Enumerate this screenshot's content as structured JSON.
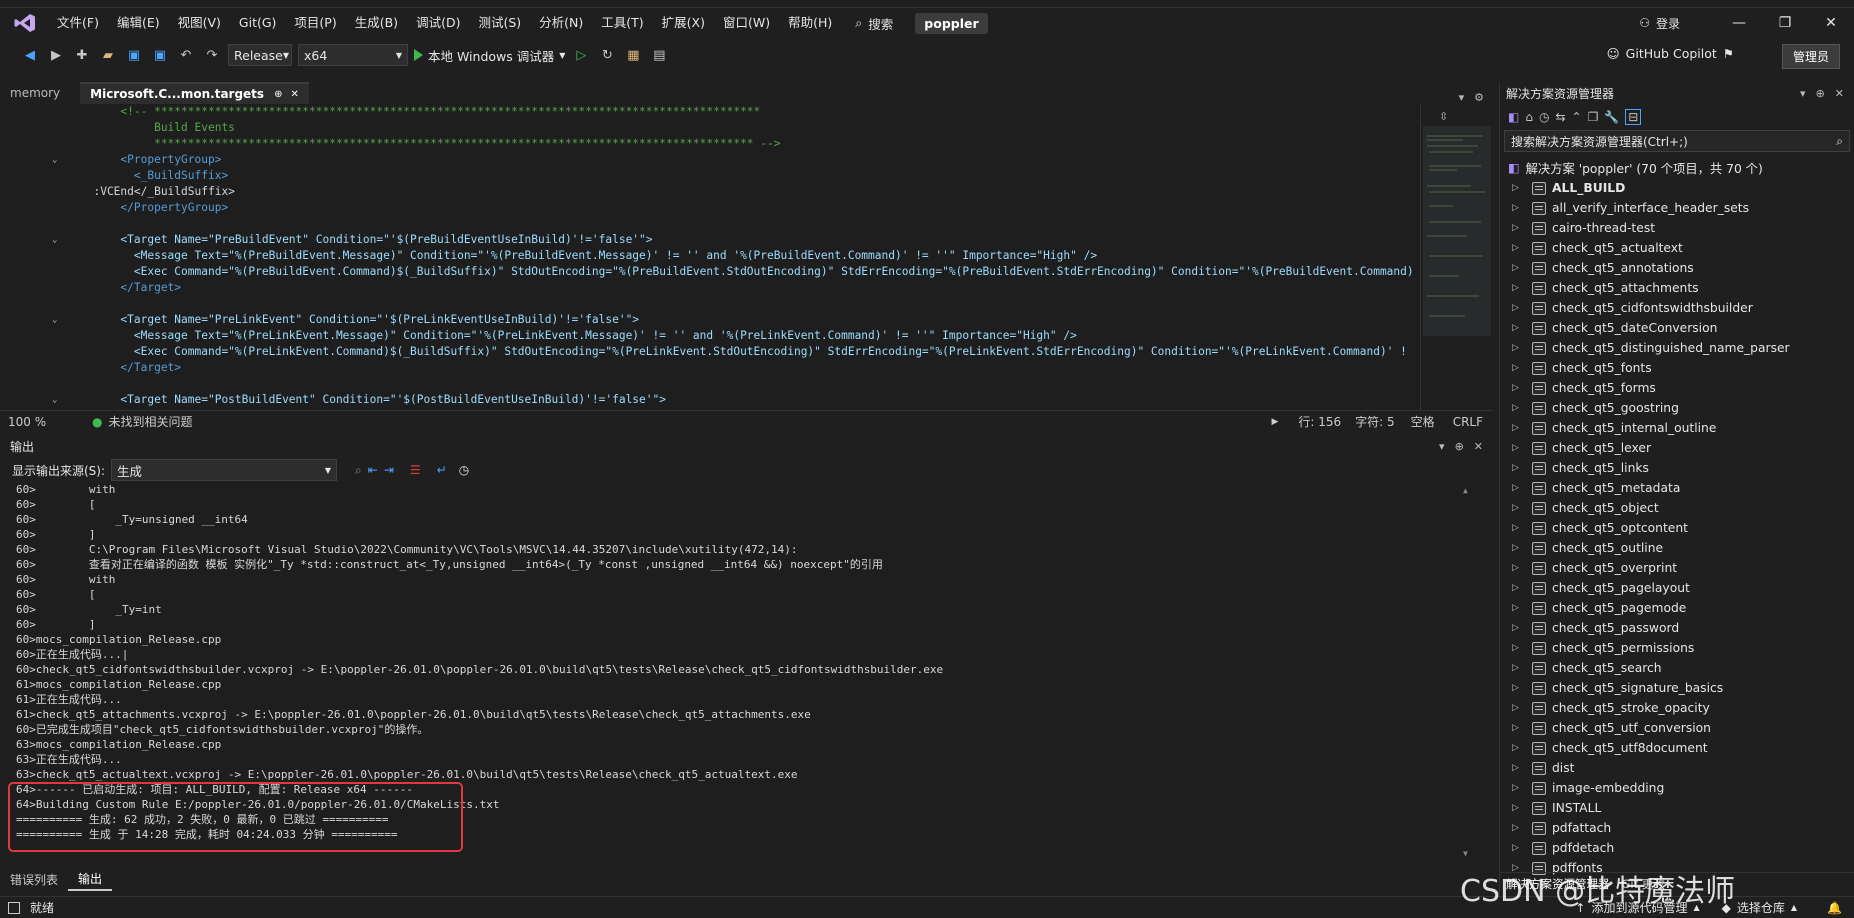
{
  "menubar": {
    "items": [
      "文件(F)",
      "编辑(E)",
      "视图(V)",
      "Git(G)",
      "项目(P)",
      "生成(B)",
      "调试(D)",
      "测试(S)",
      "分析(N)",
      "工具(T)",
      "扩展(X)",
      "窗口(W)",
      "帮助(H)"
    ],
    "search_label": "搜索",
    "project_name": "poppler",
    "login_label": "登录"
  },
  "toolbar": {
    "config": "Release",
    "platform": "x64",
    "run_label": "本地 Windows 调试器",
    "copilot_label": "GitHub Copilot",
    "manage_label": "管理员"
  },
  "tabs": [
    {
      "label": "memory"
    },
    {
      "label": "Microsoft.C...mon.targets",
      "pin": "⊕",
      "close": "✕"
    }
  ],
  "editor": {
    "lines": [
      {
        "t": "com",
        "text": "      <!-- ******************************************************************************************"
      },
      {
        "t": "com",
        "text": "           Build Events"
      },
      {
        "t": "com",
        "text": "           ***************************************************************************************** -->"
      },
      {
        "t": "tag",
        "text": "      <PropertyGroup>"
      },
      {
        "t": "tag",
        "text": "        <_BuildSuffix>"
      },
      {
        "t": "txt",
        "text": "  :VCEnd</_BuildSuffix>"
      },
      {
        "t": "tag",
        "text": "      </PropertyGroup>"
      },
      {
        "t": "txt",
        "text": ""
      },
      {
        "t": "mix",
        "text": "      <Target Name=\"PreBuildEvent\" Condition=\"'$(PreBuildEventUseInBuild)'!='false'\">"
      },
      {
        "t": "mix",
        "text": "        <Message Text=\"%(PreBuildEvent.Message)\" Condition=\"'%(PreBuildEvent.Message)' != '' and '%(PreBuildEvent.Command)' != ''\" Importance=\"High\" />"
      },
      {
        "t": "mix",
        "text": "        <Exec Command=\"%(PreBuildEvent.Command)$(_BuildSuffix)\" StdOutEncoding=\"%(PreBuildEvent.StdOutEncoding)\" StdErrEncoding=\"%(PreBuildEvent.StdErrEncoding)\" Condition=\"'%(PreBuildEvent.Command)"
      },
      {
        "t": "tag",
        "text": "      </Target>"
      },
      {
        "t": "txt",
        "text": ""
      },
      {
        "t": "mix",
        "text": "      <Target Name=\"PreLinkEvent\" Condition=\"'$(PreLinkEventUseInBuild)'!='false'\">"
      },
      {
        "t": "mix",
        "text": "        <Message Text=\"%(PreLinkEvent.Message)\" Condition=\"'%(PreLinkEvent.Message)' != '' and '%(PreLinkEvent.Command)' != ''\" Importance=\"High\" />"
      },
      {
        "t": "mix",
        "text": "        <Exec Command=\"%(PreLinkEvent.Command)$(_BuildSuffix)\" StdOutEncoding=\"%(PreLinkEvent.StdOutEncoding)\" StdErrEncoding=\"%(PreLinkEvent.StdErrEncoding)\" Condition=\"'%(PreLinkEvent.Command)' !"
      },
      {
        "t": "tag",
        "text": "      </Target>"
      },
      {
        "t": "txt",
        "text": ""
      },
      {
        "t": "mix",
        "text": "      <Target Name=\"PostBuildEvent\" Condition=\"'$(PostBuildEventUseInBuild)'!='false'\">"
      },
      {
        "t": "mix",
        "text": "        <Message Text=\"%(PostBuildEvent.Message)\" Condition=\"'%(PostBuildEvent.Message)' != '' and '%(PostBuildEvent.Command)' != ''\" Importance=\"High\" />"
      }
    ]
  },
  "editor_status": {
    "zoom": "100 %",
    "issues": "未找到相关问题",
    "line": "行: 156",
    "col": "字符: 5",
    "spacing": "空格",
    "eol": "CRLF"
  },
  "output": {
    "title": "输出",
    "source_label": "显示输出来源(S):",
    "source_value": "生成",
    "lines": [
      "60>        with",
      "60>        [",
      "60>            _Ty=unsigned __int64",
      "60>        ]",
      "60>        C:\\Program Files\\Microsoft Visual Studio\\2022\\Community\\VC\\Tools\\MSVC\\14.44.35207\\include\\xutility(472,14):",
      "60>        查看对正在编译的函数 模板 实例化\"_Ty *std::construct_at<_Ty,unsigned __int64>(_Ty *const ,unsigned __int64 &&) noexcept\"的引用",
      "60>        with",
      "60>        [",
      "60>            _Ty=int",
      "60>        ]",
      "60>mocs_compilation_Release.cpp",
      "60>正在生成代码...|",
      "60>check_qt5_cidfontswidthsbuilder.vcxproj -> E:\\poppler-26.01.0\\poppler-26.01.0\\build\\qt5\\tests\\Release\\check_qt5_cidfontswidthsbuilder.exe",
      "61>mocs_compilation_Release.cpp",
      "61>正在生成代码...",
      "61>check_qt5_attachments.vcxproj -> E:\\poppler-26.01.0\\poppler-26.01.0\\build\\qt5\\tests\\Release\\check_qt5_attachments.exe",
      "60>已完成生成项目\"check_qt5_cidfontswidthsbuilder.vcxproj\"的操作。",
      "63>mocs_compilation_Release.cpp",
      "63>正在生成代码...",
      "63>check_qt5_actualtext.vcxproj -> E:\\poppler-26.01.0\\poppler-26.01.0\\build\\qt5\\tests\\Release\\check_qt5_actualtext.exe",
      "64>------ 已启动生成: 项目: ALL_BUILD, 配置: Release x64 ------",
      "64>Building Custom Rule E:/poppler-26.01.0/poppler-26.01.0/CMakeLists.txt",
      "========== 生成: 62 成功，2 失败，0 最新，0 已跳过 ==========",
      "========== 生成 于 14:28 完成，耗时 04:24.033 分钟 =========="
    ]
  },
  "bottom_tabs": [
    "错误列表",
    "输出"
  ],
  "statusbar": {
    "ready": "就绪",
    "source_control": "添加到源代码管理",
    "repo": "选择仓库"
  },
  "solution_explorer": {
    "title": "解决方案资源管理器",
    "search_placeholder": "搜索解决方案资源管理器(Ctrl+;)",
    "solution_label": "解决方案 'poppler' (70 个项目，共 70 个)",
    "projects": [
      "ALL_BUILD",
      "all_verify_interface_header_sets",
      "cairo-thread-test",
      "check_qt5_actualtext",
      "check_qt5_annotations",
      "check_qt5_attachments",
      "check_qt5_cidfontswidthsbuilder",
      "check_qt5_dateConversion",
      "check_qt5_distinguished_name_parser",
      "check_qt5_fonts",
      "check_qt5_forms",
      "check_qt5_goostring",
      "check_qt5_internal_outline",
      "check_qt5_lexer",
      "check_qt5_links",
      "check_qt5_metadata",
      "check_qt5_object",
      "check_qt5_optcontent",
      "check_qt5_outline",
      "check_qt5_overprint",
      "check_qt5_pagelayout",
      "check_qt5_pagemode",
      "check_qt5_password",
      "check_qt5_permissions",
      "check_qt5_search",
      "check_qt5_signature_basics",
      "check_qt5_stroke_opacity",
      "check_qt5_utf_conversion",
      "check_qt5_utf8document",
      "dist",
      "image-embedding",
      "INSTALL",
      "pdfattach",
      "pdfdetach",
      "pdffonts"
    ],
    "bottom_tabs": [
      "解决方案资源管理器",
      "Git 更改"
    ]
  },
  "watermark": "CSDN @比特魔法师",
  "colors": {
    "accent": "#0e639c",
    "error_box": "#e0383e",
    "play": "#3fb950"
  }
}
